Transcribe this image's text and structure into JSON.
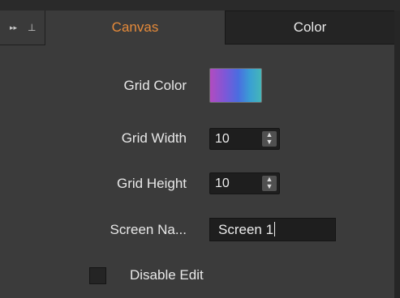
{
  "toolbar": {
    "expand_glyph": "▸▸",
    "expand_icon": "double-chevron-right-icon",
    "pin_glyph": "⊥",
    "pin_icon": "pin-icon"
  },
  "tabs": [
    {
      "label": "Canvas",
      "active": true
    },
    {
      "label": "Color",
      "active": false
    }
  ],
  "colors": {
    "active_tab": "#e58a3a",
    "background": "#3b3b3b"
  },
  "grid_color": {
    "label": "Grid Color",
    "gradient": [
      "#b24bc0",
      "#7c58d8",
      "#4a6de0",
      "#3a9fd4",
      "#45b6b8"
    ]
  },
  "grid_width": {
    "label": "Grid Width",
    "value": "10"
  },
  "grid_height": {
    "label": "Grid Height",
    "value": "10"
  },
  "screen_name": {
    "label": "Screen Na...",
    "value": "Screen 1"
  },
  "disable_edit": {
    "label": "Disable Edit",
    "checked": false
  },
  "spinner": {
    "up": "▲",
    "down": "▼"
  }
}
